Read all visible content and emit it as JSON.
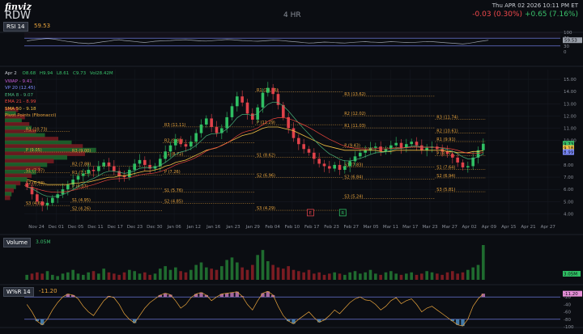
{
  "header": {
    "brand": "finviz",
    "ticker": "RDW",
    "timeframe": "4 HR",
    "datetime": "Thu APR 02 2026 10:11 PM ET",
    "change_ah": "-0.03 (0.30%)",
    "change_day": "+0.65 (7.16%)"
  },
  "colors": {
    "background": "#0b0d12",
    "up": "#2fbf63",
    "down": "#e0424a",
    "vwap": "#c45bd6",
    "ema8": "#49b37a",
    "ema21": "#e8453c",
    "sma50": "#f0c043",
    "pivot": "#e9a43c",
    "rsi": "#9aa0aa",
    "willr": "#e9a43c"
  },
  "rsi": {
    "label": "RSI 14",
    "value": "59.53",
    "levels": [
      70,
      30
    ],
    "tick_labels": [
      "100",
      "70",
      "30",
      "0"
    ],
    "series": [
      56,
      60,
      63,
      66,
      68,
      66,
      62,
      57,
      53,
      50,
      46,
      44,
      42,
      44,
      48,
      52,
      55,
      60,
      62,
      58,
      56,
      53,
      50,
      48,
      51,
      54,
      56,
      57,
      58,
      60,
      61,
      62,
      60,
      58,
      56,
      55,
      57,
      59,
      61,
      63,
      62,
      60,
      58,
      57,
      55,
      54,
      56,
      58,
      60,
      59,
      57,
      54,
      52,
      50,
      47,
      45,
      46,
      48,
      50,
      49,
      47,
      46,
      45,
      47,
      49,
      51,
      52,
      50,
      49,
      48,
      50,
      52,
      51,
      49,
      48,
      47,
      49,
      51,
      53,
      52,
      50,
      48,
      46,
      44,
      42,
      40,
      43,
      47,
      52,
      56,
      59.53
    ]
  },
  "legend": {
    "ohlc": {
      "date": "Apr 2",
      "open": "O8.68",
      "high": "H9.94",
      "low": "L8.61",
      "close": "C9.73",
      "volume": "Vol28.42M"
    },
    "indicators": [
      {
        "label": "VWAP - 9.41",
        "color": "#c45bd6"
      },
      {
        "label": "VP 20 (12.45)",
        "color": "#7d8cff"
      },
      {
        "label": "EMA 8 - 9.07",
        "color": "#49b37a"
      },
      {
        "label": "EMA 21 - 8.99",
        "color": "#e8453c"
      },
      {
        "label": "SMA 50 - 9.18",
        "color": "#f0c043"
      },
      {
        "label": "Pivot Points (Fibonacci)",
        "color": "#e9a43c"
      }
    ]
  },
  "price_axis": {
    "ticks": [
      "15.00",
      "14.00",
      "13.00",
      "12.00",
      "11.00",
      "10.00",
      "9.00",
      "8.00",
      "7.00",
      "6.00",
      "5.00",
      "4.00"
    ],
    "badges": [
      {
        "text": "9.73",
        "color": "#39c06a",
        "value": 9.73
      },
      {
        "text": "9.18",
        "color": "#f0c043",
        "value": 9.38
      },
      {
        "text": "8.99",
        "color": "#7d8cff",
        "value": 9.05
      }
    ]
  },
  "chart_data": [
    {
      "type": "candlestick",
      "title": "RDW 4 HR",
      "x_tick_labels": [
        "Nov 24",
        "Dec 01",
        "Dec 05",
        "Dec 11",
        "Dec 17",
        "Dec 23",
        "Dec 30",
        "Jan 06",
        "Jan 12",
        "Jan 16",
        "Jan 23",
        "Jan 29",
        "Feb 04",
        "Feb 10",
        "Feb 17",
        "Feb 23",
        "Feb 27",
        "Mar 05",
        "Mar 11",
        "Mar 17",
        "Mar 23",
        "Mar 27",
        "Apr 02",
        "Apr 09",
        "Apr 15",
        "Apr 21",
        "Apr 27"
      ],
      "ylim": [
        3.5,
        15.4
      ],
      "close": [
        6.2,
        5.6,
        5.0,
        4.7,
        4.9,
        5.3,
        5.6,
        6.0,
        6.4,
        6.8,
        7.1,
        7.3,
        7.6,
        7.5,
        7.9,
        8.2,
        7.9,
        7.5,
        7.1,
        7.0,
        7.6,
        8.1,
        8.4,
        8.0,
        7.7,
        7.9,
        8.5,
        9.1,
        9.6,
        10.1,
        9.7,
        9.5,
        9.9,
        10.6,
        11.3,
        11.8,
        11.1,
        10.6,
        11.0,
        11.9,
        12.8,
        13.6,
        13.1,
        12.2,
        11.7,
        12.7,
        13.9,
        14.3,
        13.8,
        12.9,
        11.9,
        11.0,
        10.2,
        9.7,
        9.3,
        9.0,
        8.5,
        8.1,
        7.9,
        7.7,
        8.0,
        7.6,
        7.9,
        8.3,
        8.7,
        9.0,
        9.2,
        9.4,
        9.5,
        9.1,
        9.3,
        9.6,
        9.8,
        9.4,
        9.7,
        9.9,
        9.6,
        9.2,
        9.4,
        9.5,
        9.3,
        9.1,
        8.9,
        8.6,
        8.2,
        7.8,
        7.9,
        8.6,
        9.2,
        9.73
      ],
      "sma50": [
        6.8,
        6.7,
        6.6,
        6.5,
        6.4,
        6.4,
        6.4,
        6.4,
        6.4,
        6.5,
        6.5,
        6.6,
        6.6,
        6.7,
        6.8,
        6.9,
        7.0,
        7.0,
        7.1,
        7.1,
        7.2,
        7.3,
        7.4,
        7.5,
        7.5,
        7.6,
        7.7,
        7.9,
        8.0,
        8.2,
        8.3,
        8.4,
        8.6,
        8.8,
        9.0,
        9.2,
        9.3,
        9.4,
        9.6,
        9.8,
        10.0,
        10.2,
        10.4,
        10.5,
        10.6,
        10.8,
        11.0,
        11.1,
        11.1,
        11.1,
        11.0,
        10.9,
        10.8,
        10.6,
        10.4,
        10.2,
        10.0,
        9.8,
        9.6,
        9.5,
        9.4,
        9.3,
        9.2,
        9.2,
        9.2,
        9.2,
        9.2,
        9.2,
        9.2,
        9.1,
        9.1,
        9.1,
        9.2,
        9.2,
        9.2,
        9.2,
        9.2,
        9.2,
        9.2,
        9.2,
        9.2,
        9.2,
        9.1,
        9.1,
        9.0,
        9.0,
        9.0,
        9.1,
        9.1,
        9.18
      ],
      "pivot_labels": [
        {
          "text": "R1 (10.73)",
          "value": 10.73,
          "x_from": 0.0,
          "x_to": 0.1
        },
        {
          "text": "P (9.05)",
          "value": 9.05,
          "x_from": 0.0,
          "x_to": 0.1
        },
        {
          "text": "S1 (7.37)",
          "value": 7.37,
          "x_from": 0.0,
          "x_to": 0.1
        },
        {
          "text": "S2 (6.33)",
          "value": 6.33,
          "x_from": 0.0,
          "x_to": 0.1
        },
        {
          "text": "S3 (4.68)",
          "value": 4.68,
          "x_from": 0.0,
          "x_to": 0.1
        },
        {
          "text": "R3 (9.00)",
          "value": 9.0,
          "x_from": 0.1,
          "x_to": 0.3
        },
        {
          "text": "R2 (7.88)",
          "value": 7.88,
          "x_from": 0.1,
          "x_to": 0.3
        },
        {
          "text": "R1 (7.19)",
          "value": 7.19,
          "x_from": 0.1,
          "x_to": 0.3
        },
        {
          "text": "P (6.07)",
          "value": 6.07,
          "x_from": 0.1,
          "x_to": 0.3
        },
        {
          "text": "S1 (4.95)",
          "value": 4.95,
          "x_from": 0.1,
          "x_to": 0.3
        },
        {
          "text": "S2 (4.26)",
          "value": 4.26,
          "x_from": 0.1,
          "x_to": 0.3
        },
        {
          "text": "R3 (11.11)",
          "value": 11.11,
          "x_from": 0.3,
          "x_to": 0.5
        },
        {
          "text": "R2 (9.83)",
          "value": 9.83,
          "x_from": 0.3,
          "x_to": 0.5
        },
        {
          "text": "R1 (8.72)",
          "value": 8.72,
          "x_from": 0.3,
          "x_to": 0.5
        },
        {
          "text": "P (7.26)",
          "value": 7.26,
          "x_from": 0.3,
          "x_to": 0.5
        },
        {
          "text": "S1 (5.76)",
          "value": 5.76,
          "x_from": 0.3,
          "x_to": 0.5
        },
        {
          "text": "S2 (4.85)",
          "value": 4.85,
          "x_from": 0.3,
          "x_to": 0.5
        },
        {
          "text": "R1 (13.96)",
          "value": 13.96,
          "x_from": 0.5,
          "x_to": 0.69
        },
        {
          "text": "P (11.29)",
          "value": 11.29,
          "x_from": 0.5,
          "x_to": 0.69
        },
        {
          "text": "S1 (8.62)",
          "value": 8.62,
          "x_from": 0.5,
          "x_to": 0.69
        },
        {
          "text": "S2 (6.96)",
          "value": 6.96,
          "x_from": 0.5,
          "x_to": 0.69
        },
        {
          "text": "S3 (4.29)",
          "value": 4.29,
          "x_from": 0.5,
          "x_to": 0.69
        },
        {
          "text": "R3 (13.62)",
          "value": 13.62,
          "x_from": 0.69,
          "x_to": 0.89
        },
        {
          "text": "R2 (12.02)",
          "value": 12.02,
          "x_from": 0.69,
          "x_to": 0.89
        },
        {
          "text": "R1 (11.03)",
          "value": 11.03,
          "x_from": 0.69,
          "x_to": 0.89
        },
        {
          "text": "P (9.43)",
          "value": 9.43,
          "x_from": 0.69,
          "x_to": 0.89
        },
        {
          "text": "S1 (7.83)",
          "value": 7.83,
          "x_from": 0.69,
          "x_to": 0.89
        },
        {
          "text": "S2 (6.84)",
          "value": 6.84,
          "x_from": 0.69,
          "x_to": 0.89
        },
        {
          "text": "S3 (5.24)",
          "value": 5.24,
          "x_from": 0.69,
          "x_to": 0.89
        },
        {
          "text": "R3 (11.74)",
          "value": 11.74,
          "x_from": 0.89,
          "x_to": 1.0
        },
        {
          "text": "R2 (10.61)",
          "value": 10.61,
          "x_from": 0.89,
          "x_to": 1.0
        },
        {
          "text": "R1 (9.91)",
          "value": 9.91,
          "x_from": 0.89,
          "x_to": 1.0
        },
        {
          "text": "P (8.77)",
          "value": 8.77,
          "x_from": 0.89,
          "x_to": 1.0
        },
        {
          "text": "S1 (7.64)",
          "value": 7.64,
          "x_from": 0.89,
          "x_to": 1.0
        },
        {
          "text": "S2 (6.94)",
          "value": 6.94,
          "x_from": 0.89,
          "x_to": 1.0
        },
        {
          "text": "S3 (5.81)",
          "value": 5.81,
          "x_from": 0.89,
          "x_to": 1.0
        }
      ],
      "events": [
        {
          "text": "E",
          "x_fraction": 0.62,
          "value": 4.1,
          "color": "#e0424a"
        },
        {
          "text": "R",
          "x_fraction": 0.69,
          "value": 4.1,
          "color": "#2fbf63"
        }
      ]
    },
    {
      "type": "bar",
      "title": "Volume",
      "value_label": "3.05M",
      "axis_badge": "3.05M",
      "values": [
        4,
        5,
        6,
        5,
        7,
        4,
        3,
        5,
        6,
        8,
        5,
        4,
        6,
        7,
        5,
        9,
        6,
        5,
        4,
        6,
        8,
        7,
        5,
        6,
        4,
        5,
        9,
        11,
        8,
        10,
        7,
        6,
        8,
        12,
        14,
        10,
        9,
        8,
        11,
        16,
        18,
        14,
        10,
        8,
        12,
        20,
        24,
        15,
        12,
        10,
        9,
        11,
        8,
        7,
        6,
        8,
        5,
        6,
        4,
        5,
        6,
        5,
        4,
        6,
        7,
        5,
        6,
        8,
        5,
        4,
        6,
        7,
        5,
        4,
        5,
        6,
        4,
        5,
        7,
        6,
        5,
        4,
        6,
        7,
        5,
        6,
        8,
        10,
        12,
        28
      ]
    },
    {
      "type": "line",
      "title": "W%R 14",
      "value_label": "-11.20",
      "axis_badge": "-11.20",
      "levels": [
        -20,
        -80
      ],
      "tick_labels": [
        "-20",
        "-40",
        "-60",
        "-80",
        "-100"
      ],
      "ylim": [
        -100,
        0
      ],
      "values": [
        -40,
        -60,
        -85,
        -95,
        -80,
        -55,
        -35,
        -20,
        -12,
        -15,
        -25,
        -45,
        -60,
        -70,
        -50,
        -30,
        -18,
        -22,
        -40,
        -65,
        -80,
        -90,
        -70,
        -50,
        -35,
        -25,
        -15,
        -10,
        -14,
        -30,
        -50,
        -40,
        -22,
        -12,
        -8,
        -15,
        -30,
        -20,
        -12,
        -10,
        -8,
        -6,
        -18,
        -40,
        -55,
        -30,
        -10,
        -5,
        -15,
        -45,
        -70,
        -85,
        -92,
        -80,
        -70,
        -60,
        -75,
        -88,
        -82,
        -70,
        -55,
        -65,
        -50,
        -35,
        -25,
        -20,
        -28,
        -30,
        -40,
        -55,
        -45,
        -30,
        -22,
        -38,
        -30,
        -25,
        -40,
        -60,
        -50,
        -45,
        -55,
        -65,
        -75,
        -85,
        -95,
        -98,
        -80,
        -45,
        -25,
        -11.2
      ]
    }
  ]
}
